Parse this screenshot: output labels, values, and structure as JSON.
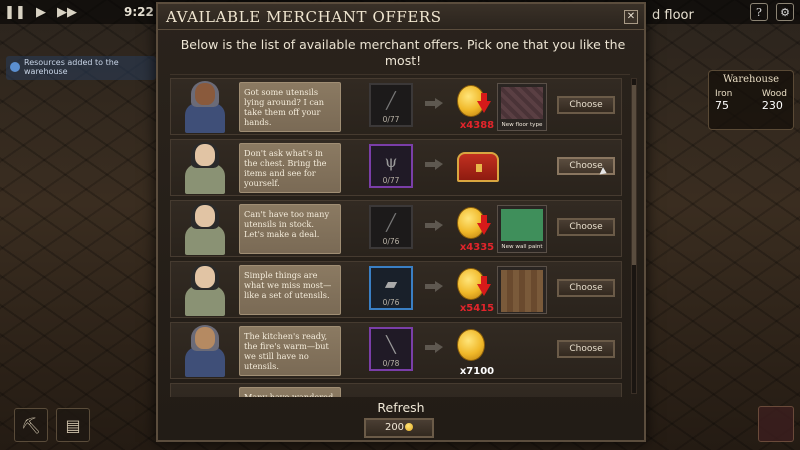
{
  "hud": {
    "time": "9:22",
    "floor_label": "d floor",
    "help": "?",
    "notification": "Resources added to the warehouse"
  },
  "warehouse": {
    "title": "Warehouse",
    "left_label": "Iron",
    "left_value": "75",
    "right_label": "Wood",
    "right_value": "230"
  },
  "modal": {
    "title": "AVAILABLE MERCHANT OFFERS",
    "description": "Below is the list of available merchant offers. Pick one that you like the most!",
    "close": "✕",
    "refresh_label": "Refresh",
    "refresh_cost": "200"
  },
  "offers": [
    {
      "text": "Got some utensils lying around? I can take them off your hands.",
      "item_count": "0/77",
      "item_icon": "utensils-icon",
      "price": "x4388",
      "reward_label": "New floor type",
      "reward_color": "#5a3f43",
      "choose": "Choose"
    },
    {
      "text": "Don't ask what's in the chest. Bring the items and see for yourself.",
      "item_count": "0/77",
      "item_icon": "fork-icon",
      "price": "",
      "reward_label": "",
      "reward_color": "",
      "choose": "Choose"
    },
    {
      "text": "Can't have too many utensils in stock. Let's make a deal.",
      "item_count": "0/76",
      "item_icon": "utensils-icon",
      "price": "x4335",
      "reward_label": "New wall paint",
      "reward_color": "#3f8f5b",
      "choose": "Choose"
    },
    {
      "text": "Simple things are what we miss most—like a set of utensils.",
      "item_count": "0/76",
      "item_icon": "cleaver-icon",
      "price": "x5415",
      "reward_label": "",
      "reward_color": "#7a5a3a",
      "choose": "Choose"
    },
    {
      "text": "The kitchen's ready, the fire's warm—but we still have no utensils.",
      "item_count": "0/78",
      "item_icon": "knife-icon",
      "price": "x7100",
      "reward_label": "",
      "reward_color": "",
      "choose": "Choose"
    },
    {
      "text": "Many have wandered",
      "item_count": "",
      "item_icon": "",
      "price": "",
      "reward_label": "",
      "reward_color": "",
      "choose": ""
    }
  ]
}
